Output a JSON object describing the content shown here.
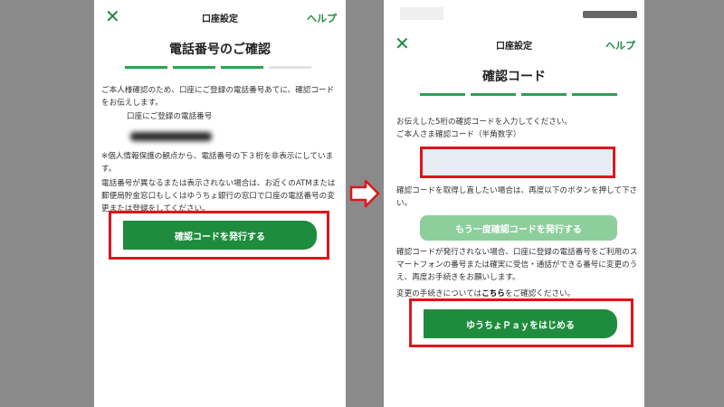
{
  "left": {
    "header": {
      "title": "口座設定",
      "help": "ヘルプ"
    },
    "title": "電話番号のご確認",
    "intro": "ご本人様確認のため、口座にご登録の電話番号あてに、確認コードをお伝えします。",
    "phone_label": "口座にご登録の電話番号",
    "note1": "※個人情報保護の観点から、電話番号の下３桁を非表示にしています。",
    "note2": "電話番号が異なるまたは表示されない場合は、お近くのATMまたは郵便局貯金窓口もしくはゆうちょ銀行の窓口で口座の電話番号の変更または登録をしてください。",
    "issue_button": "確認コードを発行する"
  },
  "right": {
    "header": {
      "title": "口座設定",
      "help": "ヘルプ"
    },
    "title": "確認コード",
    "instruction": "お伝えした5桁の確認コードを入力してください。",
    "input_label": "ご本人さま確認コード（半角数字）",
    "reissue_text": "確認コードを取得し直したい場合は、再度以下のボタンを押して下さい。",
    "reissue_button": "もう一度確認コードを発行する",
    "not_issued_text": "確認コードが発行されない場合、口座に登録の電話番号をご利用のスマートフォンの番号または確実に受信・通話ができる番号に変更のうえ、再度お手続きをお願いします。",
    "change_text": "変更の手続きについては",
    "change_link": "こちら",
    "change_suffix": "をご確認ください。",
    "start_button": "ゆうちょＰａｙをはじめる"
  },
  "colors": {
    "accent": "#1f8c3d",
    "highlight": "#e0141c"
  }
}
